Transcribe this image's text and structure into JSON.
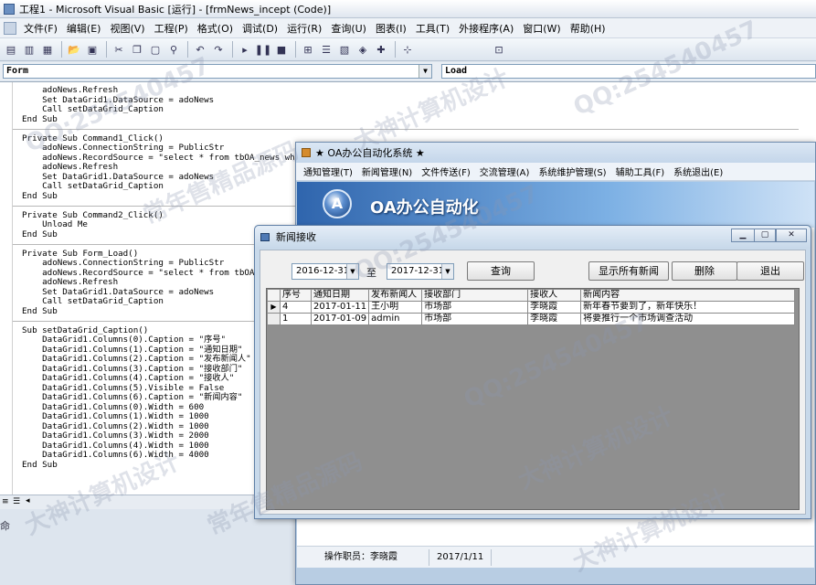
{
  "ide": {
    "title": "工程1 - Microsoft Visual Basic [运行] - [frmNews_incept (Code)]",
    "menu": [
      "文件(F)",
      "编辑(E)",
      "视图(V)",
      "工程(P)",
      "格式(O)",
      "调试(D)",
      "运行(R)",
      "查询(U)",
      "图表(I)",
      "工具(T)",
      "外接程序(A)",
      "窗口(W)",
      "帮助(H)"
    ],
    "object_combo": "Form",
    "proc_combo": "Load",
    "status_text": "命",
    "code_lines": [
      "    adoNews.Refresh",
      "    Set DataGrid1.DataSource = adoNews",
      "    Call setDataGrid_Caption",
      "End Sub",
      "",
      "Private Sub Command1_Click()",
      "    adoNews.ConnectionString = PublicStr",
      "    adoNews.RecordSource = \"select * from tbOA_news where",
      "    adoNews.Refresh",
      "    Set DataGrid1.DataSource = adoNews",
      "    Call setDataGrid_Caption",
      "End Sub",
      "",
      "Private Sub Command2_Click()",
      "    Unload Me",
      "End Sub",
      "",
      "Private Sub Form_Load()",
      "    adoNews.ConnectionString = PublicStr",
      "    adoNews.RecordSource = \"select * from tbOA_new",
      "    adoNews.Refresh",
      "    Set DataGrid1.DataSource = adoNews",
      "    Call setDataGrid_Caption",
      "End Sub",
      "",
      "Sub setDataGrid_Caption()",
      "    DataGrid1.Columns(0).Caption = \"序号\"",
      "    DataGrid1.Columns(1).Caption = \"通知日期\"",
      "    DataGrid1.Columns(2).Caption = \"发布新闻人\"",
      "    DataGrid1.Columns(3).Caption = \"接收部门\"",
      "    DataGrid1.Columns(4).Caption = \"接收人\"",
      "    DataGrid1.Columns(5).Visible = False",
      "    DataGrid1.Columns(6).Caption = \"新闻内容\"",
      "    DataGrid1.Columns(0).Width = 600",
      "    DataGrid1.Columns(1).Width = 1000",
      "    DataGrid1.Columns(2).Width = 1000",
      "    DataGrid1.Columns(3).Width = 2000",
      "    DataGrid1.Columns(4).Width = 1000",
      "    DataGrid1.Columns(6).Width = 4000",
      "End Sub"
    ]
  },
  "oa": {
    "title": "★ OA办公自动化系统 ★",
    "menu": [
      "通知管理(T)",
      "新闻管理(N)",
      "文件传送(F)",
      "交流管理(A)",
      "系统维护管理(S)",
      "辅助工具(F)",
      "系统退出(E)"
    ],
    "banner_title": "OA办公自动化",
    "logo_letter": "A",
    "status_operator": "操作职员：李晓霞",
    "status_date": "2017/1/11"
  },
  "news": {
    "title": "新闻接收",
    "date_from": "2016-12-31",
    "to_label": "至",
    "date_to": "2017-12-31",
    "query_btn": "查询",
    "show_all_btn": "显示所有新闻",
    "delete_btn": "删除",
    "exit_btn": "退出",
    "columns": [
      "序号",
      "通知日期",
      "发布新闻人",
      "接收部门",
      "接收人",
      "新闻内容"
    ],
    "rows": [
      [
        "4",
        "2017-01-11",
        "王小明",
        "市场部",
        "李晓霞",
        "新年春节要到了，新年快乐！"
      ],
      [
        "1",
        "2017-01-09",
        "admin",
        "市场部",
        "李晓霞",
        "将要推行一个市场调查活动"
      ]
    ]
  },
  "watermarks": [
    "QQ:254540457",
    "大神计算机设计",
    "常年售精品源码",
    "QQ:254540457",
    "大神计算机设计",
    "常年售精品源码",
    "QQ:254540457",
    "大神计算机设计"
  ]
}
